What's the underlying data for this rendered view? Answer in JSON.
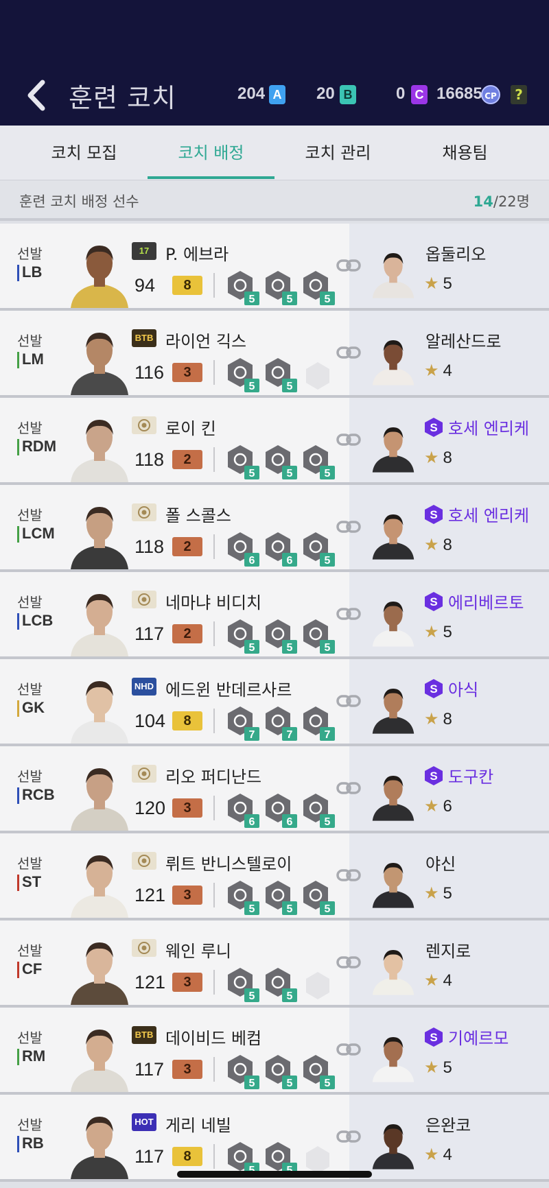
{
  "header": {
    "title": "훈련 코치",
    "currencies": [
      {
        "amount": "204",
        "badge": "A",
        "color": "#3fa1f0"
      },
      {
        "amount": "20",
        "badge": "B",
        "color": "#3bc4b4"
      },
      {
        "amount": "0",
        "badge": "C",
        "color": "#9b36e6"
      }
    ],
    "cp": {
      "amount": "16685",
      "badge": "CP"
    },
    "help_label": "?"
  },
  "tabs": [
    "코치 모집",
    "코치 배정",
    "코치 관리",
    "채용팀"
  ],
  "active_tab": 1,
  "subheader": {
    "title": "훈련 코치 배정 선수",
    "assigned": "14",
    "total": "/22명"
  },
  "players": [
    {
      "status": "선발",
      "pos": "LB",
      "pos_color": "#2e4fb7",
      "season": "17",
      "season_bg": "#3a3a3a",
      "season_fg": "#b5e14a",
      "name": "P. 에브라",
      "ovr": "94",
      "grade": "8",
      "grade_type": "gold",
      "skills": [
        "5",
        "5",
        "5"
      ],
      "coach": "옵둘리오",
      "special": false,
      "stars": "5"
    },
    {
      "status": "선발",
      "pos": "LM",
      "pos_color": "#45a046",
      "season": "BTB",
      "season_bg": "#3b2f1a",
      "season_fg": "#f2c84b",
      "name": "라이언 긱스",
      "ovr": "116",
      "grade": "3",
      "grade_type": "bronze",
      "skills": [
        "5",
        "5",
        ""
      ],
      "coach": "알레산드로",
      "special": false,
      "stars": "4"
    },
    {
      "status": "선발",
      "pos": "RDM",
      "pos_color": "#45a046",
      "season": "ICON",
      "season_bg": "#e8e1cf",
      "season_fg": "#a48a56",
      "name": "로이 킨",
      "ovr": "118",
      "grade": "2",
      "grade_type": "bronze",
      "skills": [
        "5",
        "5",
        "5"
      ],
      "coach": "호세 엔리케",
      "special": true,
      "stars": "8"
    },
    {
      "status": "선발",
      "pos": "LCM",
      "pos_color": "#45a046",
      "season": "ICON",
      "season_bg": "#e8e1cf",
      "season_fg": "#a48a56",
      "name": "폴 스콜스",
      "ovr": "118",
      "grade": "2",
      "grade_type": "bronze",
      "skills": [
        "6",
        "6",
        "5"
      ],
      "coach": "호세 엔리케",
      "special": true,
      "stars": "8"
    },
    {
      "status": "선발",
      "pos": "LCB",
      "pos_color": "#2e4fb7",
      "season": "ICON",
      "season_bg": "#e8e1cf",
      "season_fg": "#a48a56",
      "name": "네마냐 비디치",
      "ovr": "117",
      "grade": "2",
      "grade_type": "bronze",
      "skills": [
        "5",
        "5",
        "5"
      ],
      "coach": "에리베르토",
      "special": true,
      "stars": "5"
    },
    {
      "status": "선발",
      "pos": "GK",
      "pos_color": "#d3a83c",
      "season": "NHD",
      "season_bg": "#2b4f9e",
      "season_fg": "#ffffff",
      "name": "에드윈 반데르사르",
      "ovr": "104",
      "grade": "8",
      "grade_type": "gold",
      "skills": [
        "7",
        "7",
        "7"
      ],
      "coach": "아식",
      "special": true,
      "stars": "8"
    },
    {
      "status": "선발",
      "pos": "RCB",
      "pos_color": "#2e4fb7",
      "season": "ICON",
      "season_bg": "#e8e1cf",
      "season_fg": "#a48a56",
      "name": "리오 퍼디난드",
      "ovr": "120",
      "grade": "3",
      "grade_type": "bronze",
      "skills": [
        "6",
        "6",
        "5"
      ],
      "coach": "도구칸",
      "special": true,
      "stars": "6"
    },
    {
      "status": "선발",
      "pos": "ST",
      "pos_color": "#c0392b",
      "season": "ICON",
      "season_bg": "#e8e1cf",
      "season_fg": "#a48a56",
      "name": "뤼트 반니스텔로이",
      "ovr": "121",
      "grade": "3",
      "grade_type": "bronze",
      "skills": [
        "5",
        "5",
        "5"
      ],
      "coach": "야신",
      "special": false,
      "stars": "5"
    },
    {
      "status": "선발",
      "pos": "CF",
      "pos_color": "#c0392b",
      "season": "ICON",
      "season_bg": "#e8e1cf",
      "season_fg": "#a48a56",
      "name": "웨인 루니",
      "ovr": "121",
      "grade": "3",
      "grade_type": "bronze",
      "skills": [
        "5",
        "5",
        ""
      ],
      "coach": "렌지로",
      "special": false,
      "stars": "4"
    },
    {
      "status": "선발",
      "pos": "RM",
      "pos_color": "#45a046",
      "season": "BTB",
      "season_bg": "#3b2f1a",
      "season_fg": "#f2c84b",
      "name": "데이비드 베컴",
      "ovr": "117",
      "grade": "3",
      "grade_type": "bronze",
      "skills": [
        "5",
        "5",
        "5"
      ],
      "coach": "기예르모",
      "special": true,
      "stars": "5"
    },
    {
      "status": "선발",
      "pos": "RB",
      "pos_color": "#2e4fb7",
      "season": "HOT",
      "season_bg": "#3c2fb5",
      "season_fg": "#ffffff",
      "name": "게리 네빌",
      "ovr": "117",
      "grade": "8",
      "grade_type": "gold",
      "skills": [
        "5",
        "5",
        ""
      ],
      "coach": "은완코",
      "special": false,
      "stars": "4"
    }
  ]
}
